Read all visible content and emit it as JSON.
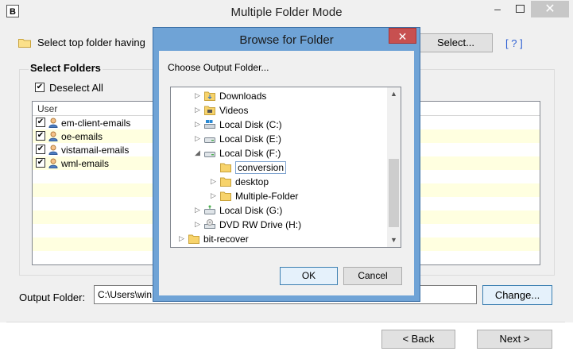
{
  "window": {
    "title": "Multiple Folder Mode",
    "app_icon_letter": "B",
    "minimize": "–",
    "close": "✕"
  },
  "top": {
    "label": "Select top folder having",
    "select_button": "Select...",
    "help_link": "[ ? ]"
  },
  "select_folders": {
    "legend": "Select Folders",
    "deselect_all": "Deselect All",
    "column_user": "User",
    "rows": [
      {
        "label": "em-client-emails",
        "checked": true
      },
      {
        "label": "oe-emails",
        "checked": true
      },
      {
        "label": "vistamail-emails",
        "checked": true
      },
      {
        "label": "wml-emails",
        "checked": true
      }
    ],
    "row_highlight": "#ffffe0"
  },
  "output": {
    "label": "Output Folder:",
    "value": "C:\\Users\\win",
    "change_button": "Change..."
  },
  "footer": {
    "back_button": "< Back",
    "next_button": "Next >"
  },
  "dialog": {
    "title": "Browse for Folder",
    "close": "✕",
    "prompt": "Choose Output Folder...",
    "tree": [
      {
        "label": "Downloads",
        "icon": "downloads-folder-icon"
      },
      {
        "label": "Videos",
        "icon": "videos-folder-icon"
      },
      {
        "label": "Local Disk (C:)",
        "icon": "windows-drive-icon"
      },
      {
        "label": "Local Disk (E:)",
        "icon": "drive-icon"
      },
      {
        "label": "Local Disk (F:)",
        "icon": "drive-icon",
        "expanded": true
      },
      {
        "label": "conversion",
        "icon": "folder-icon",
        "selected": true
      },
      {
        "label": "desktop",
        "icon": "folder-icon"
      },
      {
        "label": "Multiple-Folder",
        "icon": "folder-icon"
      },
      {
        "label": "Local Disk (G:)",
        "icon": "network-drive-icon"
      },
      {
        "label": "DVD RW Drive (H:)",
        "icon": "dvd-drive-icon"
      },
      {
        "label": "bit-recover",
        "icon": "folder-icon"
      }
    ],
    "ok_button": "OK",
    "cancel_button": "Cancel"
  },
  "colors": {
    "dialog_frame": "#6fa3d6",
    "close_red": "#c75050",
    "link_blue": "#2d5fd3",
    "folder_yellow": "#f2c94c"
  }
}
